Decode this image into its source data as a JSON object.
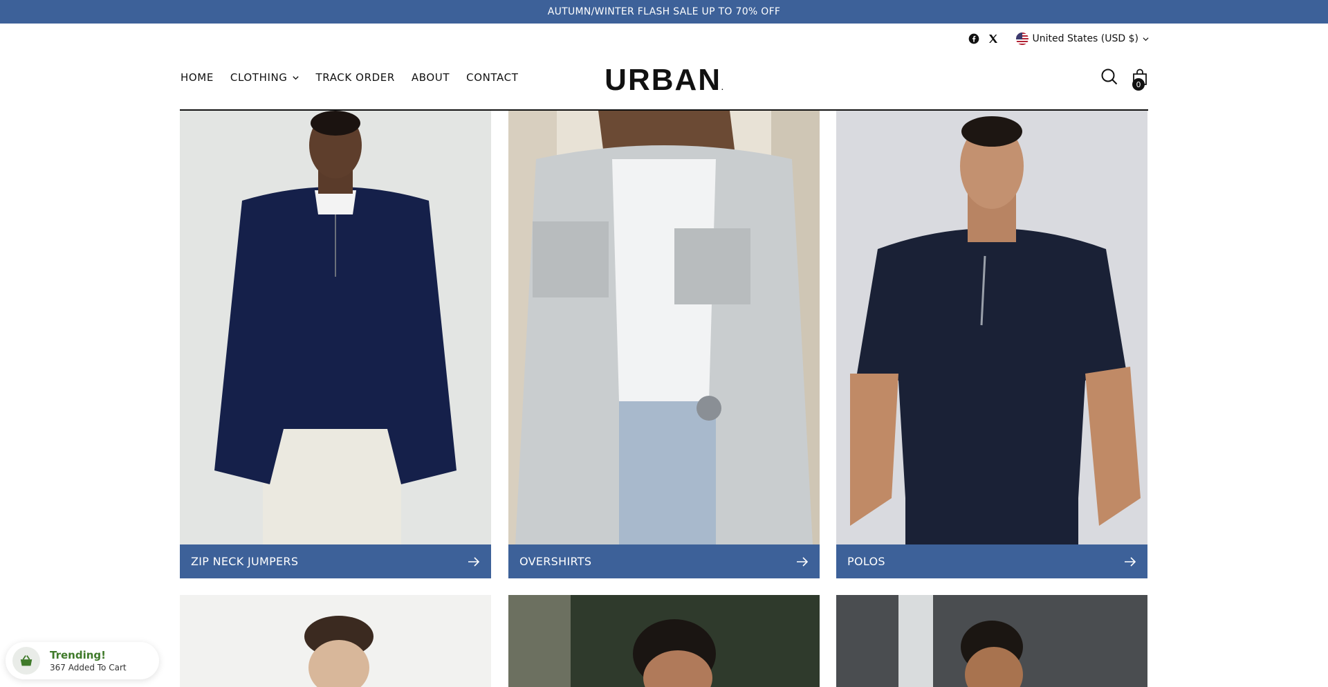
{
  "announcement": {
    "text": "AUTUMN/WINTER FLASH SALE UP TO 70% OFF"
  },
  "utility": {
    "social": [
      "facebook-icon",
      "x-icon"
    ],
    "country_label": "United States (USD $)"
  },
  "nav": {
    "items": [
      {
        "label": "HOME",
        "has_dropdown": false
      },
      {
        "label": "CLOTHING",
        "has_dropdown": true
      },
      {
        "label": "TRACK ORDER",
        "has_dropdown": false
      },
      {
        "label": "ABOUT",
        "has_dropdown": false
      },
      {
        "label": "CONTACT",
        "has_dropdown": false
      }
    ]
  },
  "brand": {
    "logo_text": "URBAN",
    "logo_mark": "."
  },
  "header_icons": {
    "search": "search-icon",
    "cart": "bag-icon",
    "cart_count": "0"
  },
  "collections": [
    {
      "label": "ZIP NECK JUMPERS"
    },
    {
      "label": "OVERSHIRTS"
    },
    {
      "label": "POLOS"
    }
  ],
  "trending_popup": {
    "title": "Trending!",
    "subtitle": "367 Added To Cart"
  },
  "colors": {
    "accent": "#3d6199",
    "trending": "#3f7a2a"
  }
}
